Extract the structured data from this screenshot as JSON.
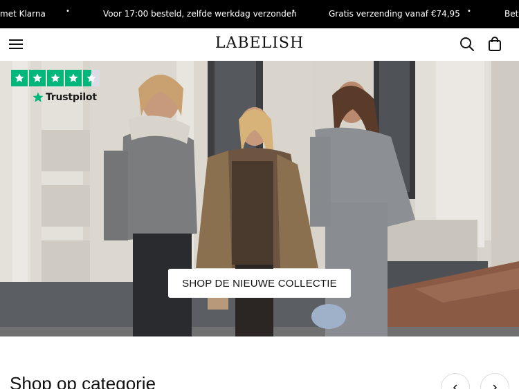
{
  "announcement": {
    "messages": [
      "met Klarna",
      "Voor 17:00 besteld, zelfde werkdag verzonden",
      "Gratis verzending vanaf €74,95",
      "Beta"
    ],
    "separator": "•"
  },
  "header": {
    "logo": "LABELISH",
    "icons": [
      "menu-icon",
      "search-icon",
      "shopping-bag-icon"
    ]
  },
  "trustpilot": {
    "rating_stars": 4.5,
    "label": "Trustpilot",
    "color": "#00b67a"
  },
  "hero": {
    "cta_label": "SHOP DE NIEUWE COLLECTIE"
  },
  "categories": {
    "title": "Shop op categorie",
    "prev_icon": "chevron-left-icon",
    "next_icon": "chevron-right-icon"
  }
}
